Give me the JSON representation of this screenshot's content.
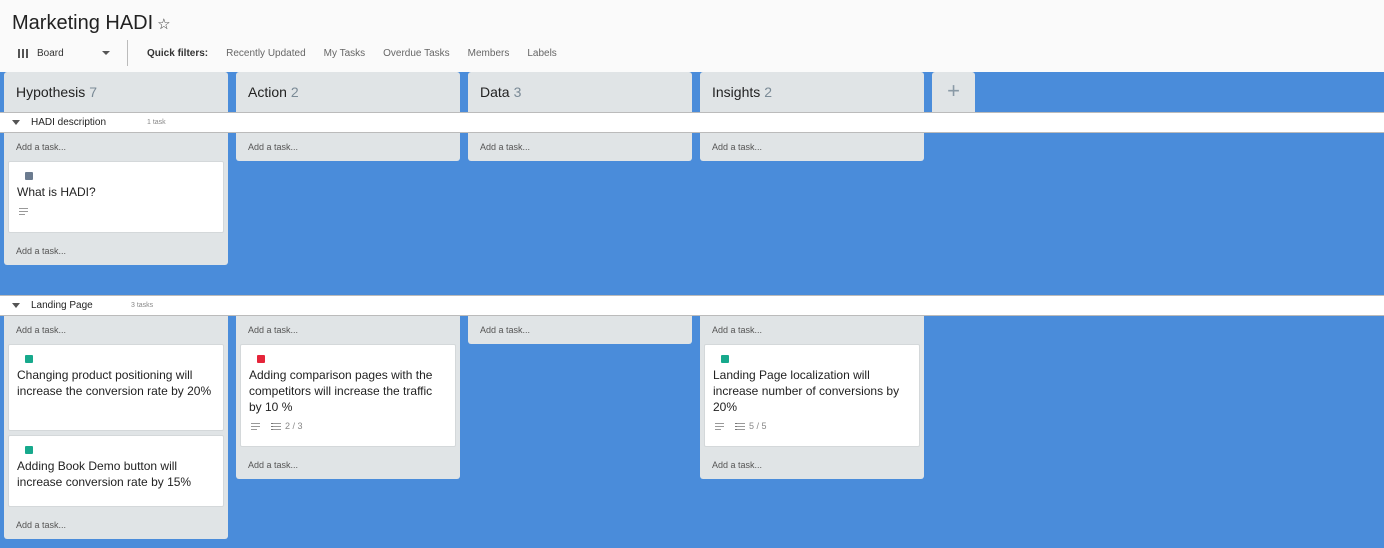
{
  "board": {
    "title": "Marketing HADI",
    "view_label": "Board",
    "quick_filters_label": "Quick filters:",
    "filters": [
      "Recently Updated",
      "My Tasks",
      "Overdue Tasks",
      "Members",
      "Labels"
    ]
  },
  "columns": [
    {
      "name": "Hypothesis",
      "count": "7"
    },
    {
      "name": "Action",
      "count": "2"
    },
    {
      "name": "Data",
      "count": "3"
    },
    {
      "name": "Insights",
      "count": "2"
    }
  ],
  "add_column_label": "+",
  "add_task_label": "Add a task...",
  "colors": {
    "background": "#4a8cda",
    "label_gray": "#6b7b8f",
    "label_teal": "#17a98c",
    "label_red": "#e5253a"
  },
  "lanes": [
    {
      "name": "HADI description",
      "count": "1 task",
      "cards": {
        "hypothesis": [
          {
            "title": "What is HADI?",
            "label_color": "#6b7b8f"
          }
        ]
      }
    },
    {
      "name": "Landing Page",
      "count": "3 tasks",
      "cards": {
        "hypothesis": [
          {
            "title": "Changing product positioning will increase the conversion rate by 20%",
            "label_color": "#17a98c"
          },
          {
            "title": "Adding Book Demo button will increase conversion rate by 15%",
            "label_color": "#17a98c"
          }
        ],
        "action": [
          {
            "title": "Adding comparison pages with the competitors will increase the traffic by 10 %",
            "label_color": "#e5253a",
            "checklist": "2 / 3"
          }
        ],
        "insights": [
          {
            "title": "Landing Page localization will increase number of conversions by 20%",
            "label_color": "#17a98c",
            "checklist": "5 / 5"
          }
        ]
      }
    }
  ]
}
